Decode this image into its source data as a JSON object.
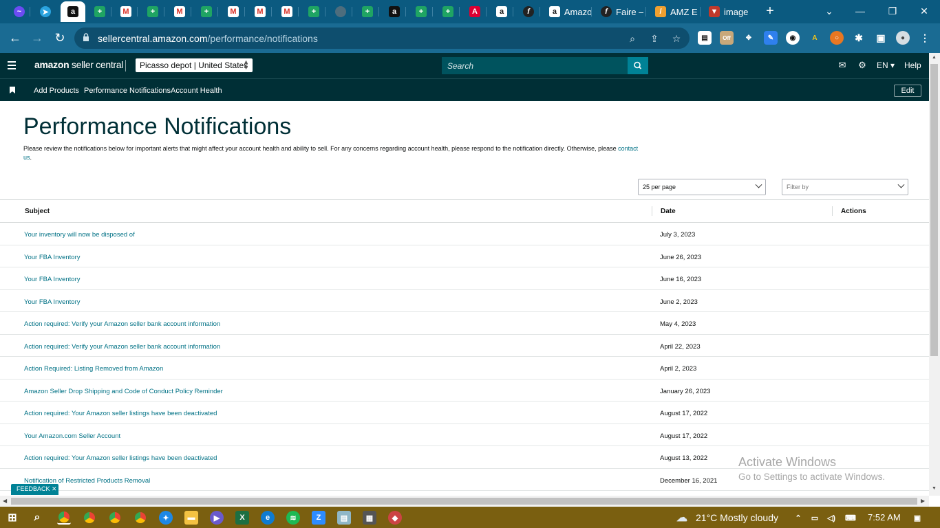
{
  "browser": {
    "tabs": [
      {
        "title": ""
      },
      {
        "title": ""
      },
      {
        "title": ""
      },
      {
        "title": ""
      },
      {
        "title": ""
      },
      {
        "title": ""
      },
      {
        "title": ""
      },
      {
        "title": ""
      },
      {
        "title": ""
      },
      {
        "title": ""
      },
      {
        "title": ""
      },
      {
        "title": ""
      },
      {
        "title": ""
      },
      {
        "title": ""
      },
      {
        "title": ""
      },
      {
        "title": ""
      },
      {
        "title": ""
      },
      {
        "title": ""
      },
      {
        "title": ""
      },
      {
        "title": ""
      },
      {
        "title": "Amazo"
      },
      {
        "title": "Faire –"
      },
      {
        "title": "AMZ E"
      },
      {
        "title": "image"
      }
    ],
    "new_tab": "+",
    "url_domain": "sellercentral.amazon.com",
    "url_path": "/performance/notifications"
  },
  "header": {
    "logo_bold": "amazon",
    "logo_rest": " seller central",
    "store": "Picasso depot | United States",
    "search_placeholder": "Search",
    "language": "EN",
    "help": "Help"
  },
  "nav": {
    "items": [
      "Add Products",
      "Performance Notifications",
      "Account Health"
    ],
    "edit_label": "Edit"
  },
  "page": {
    "title": "Performance Notifications",
    "description": "Please review the notifications below for important alerts that might affect your account health and ability to sell. For any concerns regarding account health, please respond to the notification directly. Otherwise, please",
    "contact_link": "contact us",
    "per_page": "25 per page",
    "filter_placeholder": "Filter by"
  },
  "table": {
    "headers": {
      "subject": "Subject",
      "date": "Date",
      "actions": "Actions"
    },
    "rows": [
      {
        "subject": "Your inventory will now be disposed of",
        "date": "July 3, 2023"
      },
      {
        "subject": "Your FBA Inventory",
        "date": "June 26, 2023"
      },
      {
        "subject": "Your FBA Inventory",
        "date": "June 16, 2023"
      },
      {
        "subject": "Your FBA Inventory",
        "date": "June 2, 2023"
      },
      {
        "subject": "Action required: Verify your Amazon seller bank account information",
        "date": "May 4, 2023"
      },
      {
        "subject": "Action required: Verify your Amazon seller bank account information",
        "date": "April 22, 2023"
      },
      {
        "subject": "Action Required: Listing Removed from Amazon",
        "date": "April 2, 2023"
      },
      {
        "subject": "Amazon Seller Drop Shipping and Code of Conduct Policy Reminder",
        "date": "January 26, 2023"
      },
      {
        "subject": "Action required: Your Amazon seller listings have been deactivated",
        "date": "August 17, 2022"
      },
      {
        "subject": "Your Amazon.com Seller Account",
        "date": "August 17, 2022"
      },
      {
        "subject": "Action required: Your Amazon seller listings have been deactivated",
        "date": "August 13, 2022"
      },
      {
        "subject": "Notification of Restricted Products Removal",
        "date": "December 16, 2021"
      }
    ]
  },
  "feedback": "FEEDBACK ✕",
  "watermark": {
    "line1": "Activate Windows",
    "line2": "Go to Settings to activate Windows."
  },
  "taskbar": {
    "weather": "21°C  Mostly cloudy",
    "time": "7:52 AM"
  },
  "colors": {
    "tab_strip": "#0b5a80",
    "address_bar": "#1a6b93",
    "sc_header": "#002f36",
    "link": "#007185",
    "taskbar": "#7a5f10"
  }
}
